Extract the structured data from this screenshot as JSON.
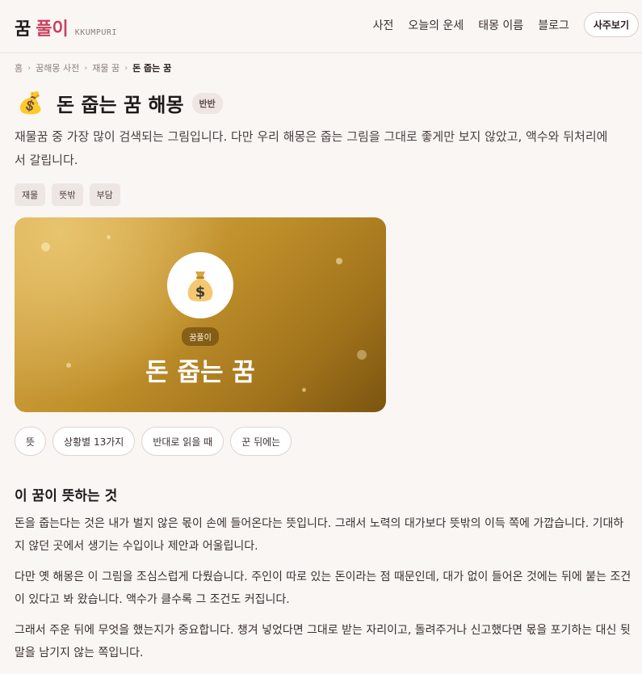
{
  "header": {
    "logo_main": "꿈",
    "logo_accent": "풀이",
    "logo_sub": "KKUMPURI",
    "nav": [
      "사전",
      "오늘의 운세",
      "태몽 이름",
      "블로그"
    ],
    "cta": "사주보기"
  },
  "breadcrumb": [
    "홈",
    "꿈해몽 사전",
    "재물 꿈",
    "돈 줍는 꿈"
  ],
  "page": {
    "emoji": "💰",
    "title": "돈 줍는 꿈 해몽",
    "verdict": "반반",
    "intro": "재물꿈 중 가장 많이 검색되는 그림입니다. 다만 우리 해몽은 줍는 그림을 그대로 좋게만 보지 않았고, 액수와 뒤처리에서 갈립니다.",
    "tags": [
      "재물",
      "뜻밖",
      "부담"
    ]
  },
  "hero": {
    "emoji": "💰",
    "badge": "꿈풀이",
    "title": "돈 줍는 꿈"
  },
  "section_tabs": [
    "뜻",
    "상황별 13가지",
    "반대로 읽을 때",
    "꾼 뒤에는"
  ],
  "section": {
    "title": "이 꿈이 뜻하는 것",
    "paragraphs": [
      "돈을 줍는다는 것은 내가 벌지 않은 몫이 손에 들어온다는 뜻입니다. 그래서 노력의 대가보다 뜻밖의 이득 쪽에 가깝습니다. 기대하지 않던 곳에서 생기는 수입이나 제안과 어울립니다.",
      "다만 옛 해몽은 이 그림을 조심스럽게 다뤘습니다. 주인이 따로 있는 돈이라는 점 때문인데, 대가 없이 들어온 것에는 뒤에 붙는 조건이 있다고 봐 왔습니다. 액수가 클수록 그 조건도 커집니다.",
      "그래서 주운 뒤에 무엇을 했는지가 중요합니다. 챙겨 넣었다면 그대로 받는 자리이고, 돌려주거나 신고했다면 몫을 포기하는 대신 뒷말을 남기지 않는 쪽입니다."
    ]
  }
}
